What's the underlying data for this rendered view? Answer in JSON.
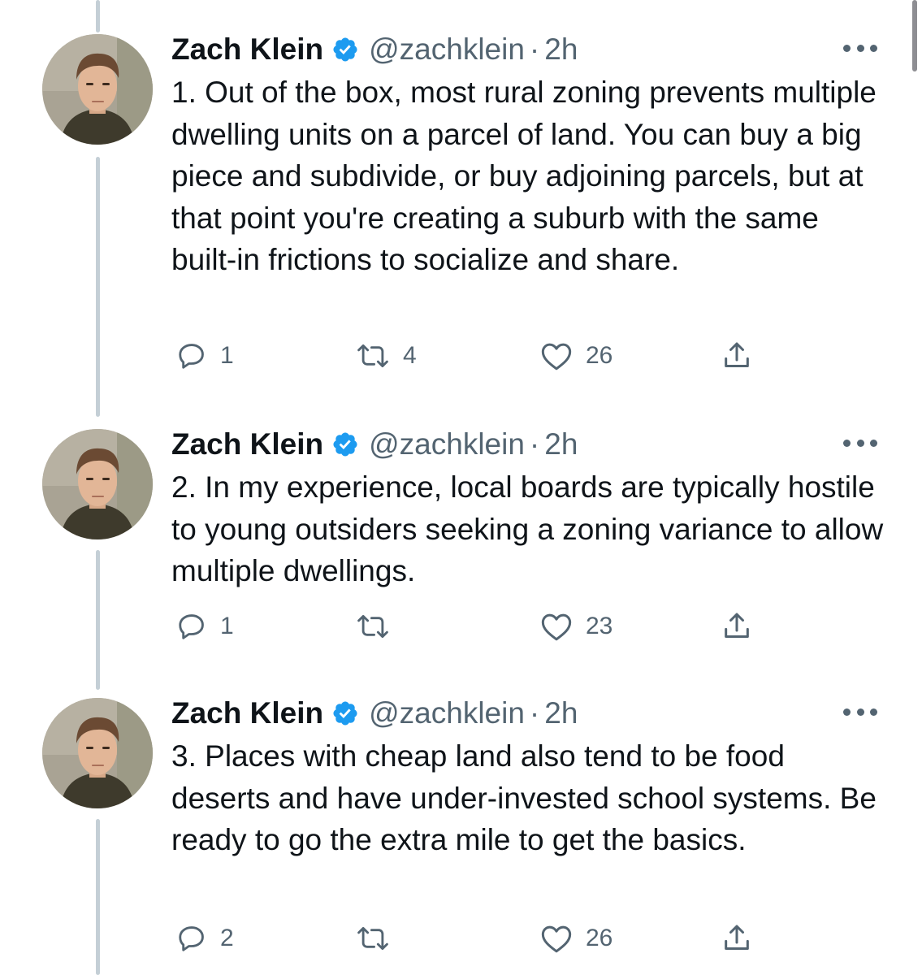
{
  "colors": {
    "verified": "#1d9bf0",
    "muted": "#536471",
    "text": "#0f1419",
    "thread_line": "#c4cfd6"
  },
  "tweets": [
    {
      "name": "Zach Klein",
      "handle": "@zachklein",
      "separator": "·",
      "time": "2h",
      "text": "1. Out of the box, most rural zoning prevents multiple dwelling units on a parcel of land. You can buy a big piece and subdivide, or buy adjoining parcels, but at that point you're creating a suburb with the same built-in frictions to socialize and share.",
      "replies": "1",
      "retweets": "4",
      "likes": "26"
    },
    {
      "name": "Zach Klein",
      "handle": "@zachklein",
      "separator": "·",
      "time": "2h",
      "text": "2. In my experience, local boards are typically hostile to young outsiders seeking a zoning variance to allow multiple dwellings.",
      "replies": "1",
      "retweets": "",
      "likes": "23"
    },
    {
      "name": "Zach Klein",
      "handle": "@zachklein",
      "separator": "·",
      "time": "2h",
      "text": "3. Places with cheap land also tend to be food deserts and have under-invested school systems. Be ready to go the extra mile to get the basics.",
      "replies": "2",
      "retweets": "",
      "likes": "26"
    }
  ]
}
